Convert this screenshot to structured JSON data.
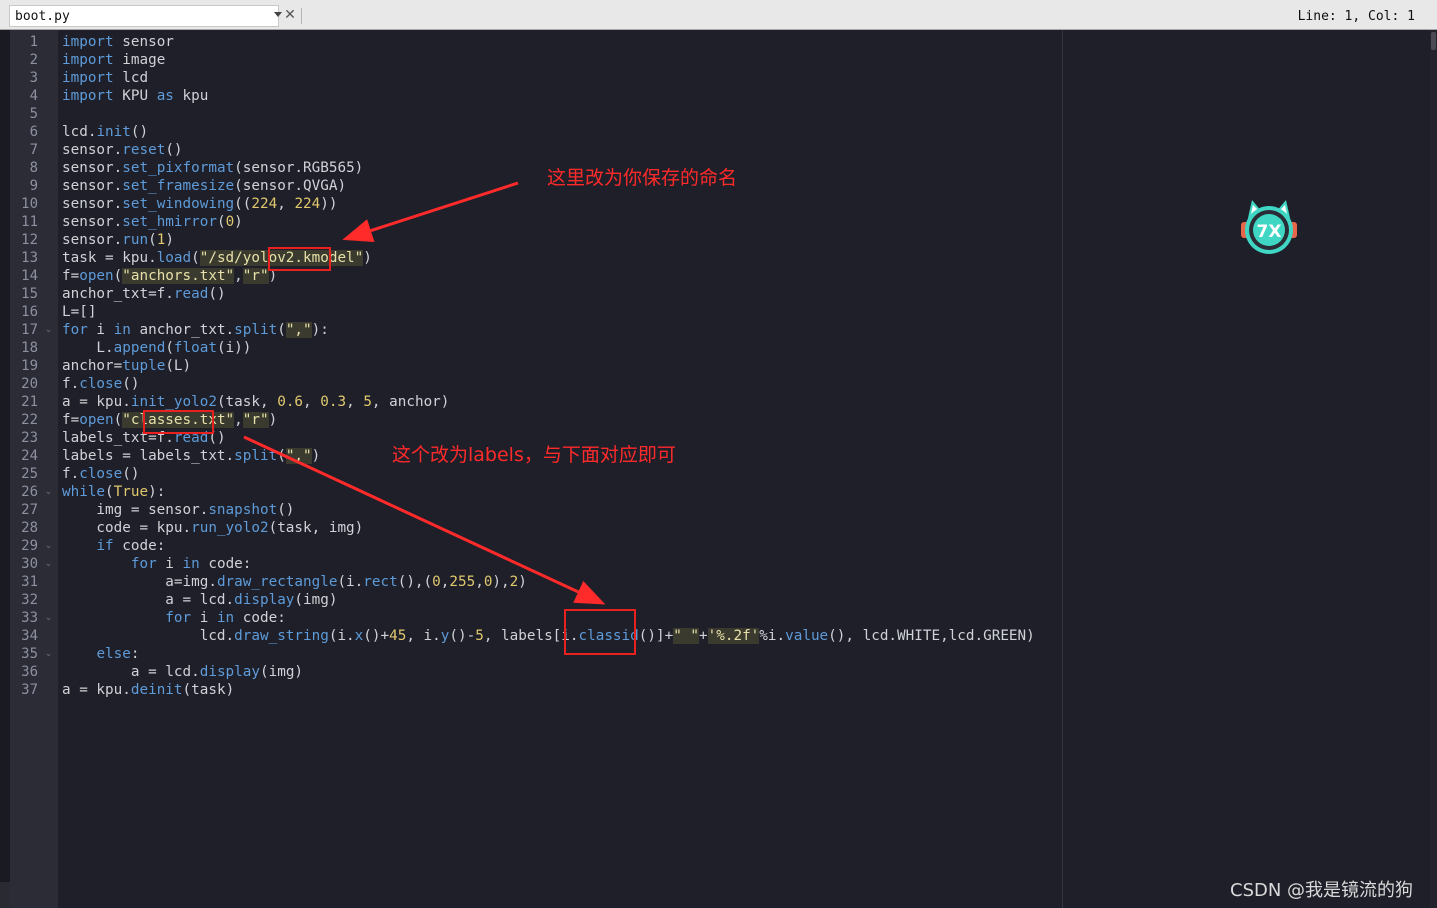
{
  "tab": {
    "filename": "boot.py",
    "close_symbol": "✕"
  },
  "status_bar": {
    "cursor": "Line: 1, Col: 1"
  },
  "code_lines": [
    [
      [
        "import",
        "kw"
      ],
      [
        " sensor",
        ""
      ]
    ],
    [
      [
        "import",
        "kw"
      ],
      [
        " image",
        ""
      ]
    ],
    [
      [
        "import",
        "kw"
      ],
      [
        " lcd",
        ""
      ]
    ],
    [
      [
        "import",
        "kw"
      ],
      [
        " KPU ",
        ""
      ],
      [
        "as",
        "kw"
      ],
      [
        " kpu",
        ""
      ]
    ],
    [],
    [
      [
        "lcd.",
        ""
      ],
      [
        "init",
        "fn"
      ],
      [
        "()",
        ""
      ]
    ],
    [
      [
        "sensor.",
        ""
      ],
      [
        "reset",
        "fn"
      ],
      [
        "()",
        ""
      ]
    ],
    [
      [
        "sensor.",
        ""
      ],
      [
        "set_pixformat",
        "fn"
      ],
      [
        "(sensor.RGB565)",
        ""
      ]
    ],
    [
      [
        "sensor.",
        ""
      ],
      [
        "set_framesize",
        "fn"
      ],
      [
        "(sensor.QVGA)",
        ""
      ]
    ],
    [
      [
        "sensor.",
        ""
      ],
      [
        "set_windowing",
        "fn"
      ],
      [
        "((",
        ""
      ],
      [
        "224",
        "num"
      ],
      [
        ", ",
        ""
      ],
      [
        "224",
        "num"
      ],
      [
        "))",
        ""
      ]
    ],
    [
      [
        "sensor.",
        ""
      ],
      [
        "set_hmirror",
        "fn"
      ],
      [
        "(",
        ""
      ],
      [
        "0",
        "num"
      ],
      [
        ")",
        ""
      ]
    ],
    [
      [
        "sensor.",
        ""
      ],
      [
        "run",
        "fn"
      ],
      [
        "(",
        ""
      ],
      [
        "1",
        "num"
      ],
      [
        ")",
        ""
      ]
    ],
    [
      [
        "task = kpu.",
        ""
      ],
      [
        "load",
        "fn"
      ],
      [
        "(",
        ""
      ],
      [
        "\"/sd/yolov2.kmodel\"",
        "str"
      ],
      [
        ")",
        ""
      ]
    ],
    [
      [
        "f=",
        ""
      ],
      [
        "open",
        "fn"
      ],
      [
        "(",
        ""
      ],
      [
        "\"anchors.txt\"",
        "str"
      ],
      [
        ",",
        ""
      ],
      [
        "\"r\"",
        "str"
      ],
      [
        ")",
        ""
      ]
    ],
    [
      [
        "anchor_txt=f.",
        ""
      ],
      [
        "read",
        "fn"
      ],
      [
        "()",
        ""
      ]
    ],
    [
      [
        "L=[]",
        ""
      ]
    ],
    [
      [
        "for",
        "kw"
      ],
      [
        " i ",
        ""
      ],
      [
        "in",
        "kw"
      ],
      [
        " anchor_txt.",
        ""
      ],
      [
        "split",
        "fn"
      ],
      [
        "(",
        ""
      ],
      [
        "\",\"",
        "str"
      ],
      [
        "):",
        ""
      ]
    ],
    [
      [
        "    L.",
        ""
      ],
      [
        "append",
        "fn"
      ],
      [
        "(",
        ""
      ],
      [
        "float",
        "fn"
      ],
      [
        "(i))",
        ""
      ]
    ],
    [
      [
        "anchor=",
        ""
      ],
      [
        "tuple",
        "fn"
      ],
      [
        "(L)",
        ""
      ]
    ],
    [
      [
        "f.",
        ""
      ],
      [
        "close",
        "fn"
      ],
      [
        "()",
        ""
      ]
    ],
    [
      [
        "a = kpu.",
        ""
      ],
      [
        "init_yolo2",
        "fn"
      ],
      [
        "(task, ",
        ""
      ],
      [
        "0.6",
        "num"
      ],
      [
        ", ",
        ""
      ],
      [
        "0.3",
        "num"
      ],
      [
        ", ",
        ""
      ],
      [
        "5",
        "num"
      ],
      [
        ", anchor)",
        ""
      ]
    ],
    [
      [
        "f=",
        ""
      ],
      [
        "open",
        "fn"
      ],
      [
        "(",
        ""
      ],
      [
        "\"classes.txt\"",
        "str"
      ],
      [
        ",",
        ""
      ],
      [
        "\"r\"",
        "str"
      ],
      [
        ")",
        ""
      ]
    ],
    [
      [
        "labels_txt=f.",
        ""
      ],
      [
        "read",
        "fn"
      ],
      [
        "()",
        ""
      ]
    ],
    [
      [
        "labels = labels_txt.",
        ""
      ],
      [
        "split",
        "fn"
      ],
      [
        "(",
        ""
      ],
      [
        "\",\"",
        "str"
      ],
      [
        ")",
        ""
      ]
    ],
    [
      [
        "f.",
        ""
      ],
      [
        "close",
        "fn"
      ],
      [
        "()",
        ""
      ]
    ],
    [
      [
        "while",
        "kw"
      ],
      [
        "(",
        ""
      ],
      [
        "True",
        "num"
      ],
      [
        "):",
        ""
      ]
    ],
    [
      [
        "    img = sensor.",
        ""
      ],
      [
        "snapshot",
        "fn"
      ],
      [
        "()",
        ""
      ]
    ],
    [
      [
        "    code = kpu.",
        ""
      ],
      [
        "run_yolo2",
        "fn"
      ],
      [
        "(task, img)",
        ""
      ]
    ],
    [
      [
        "    ",
        ""
      ],
      [
        "if",
        "kw"
      ],
      [
        " code:",
        ""
      ]
    ],
    [
      [
        "        ",
        ""
      ],
      [
        "for",
        "kw"
      ],
      [
        " i ",
        ""
      ],
      [
        "in",
        "kw"
      ],
      [
        " code:",
        ""
      ]
    ],
    [
      [
        "            a=img.",
        ""
      ],
      [
        "draw_rectangle",
        "fn"
      ],
      [
        "(i.",
        ""
      ],
      [
        "rect",
        "fn"
      ],
      [
        "(),(",
        ""
      ],
      [
        "0",
        "num"
      ],
      [
        ",",
        ""
      ],
      [
        "255",
        "num"
      ],
      [
        ",",
        ""
      ],
      [
        "0",
        "num"
      ],
      [
        "),",
        ""
      ],
      [
        "2",
        "num"
      ],
      [
        ")",
        ""
      ]
    ],
    [
      [
        "            a = lcd.",
        ""
      ],
      [
        "display",
        "fn"
      ],
      [
        "(img)",
        ""
      ]
    ],
    [
      [
        "            ",
        ""
      ],
      [
        "for",
        "kw"
      ],
      [
        " i ",
        ""
      ],
      [
        "in",
        "kw"
      ],
      [
        " code:",
        ""
      ]
    ],
    [
      [
        "                lcd.",
        ""
      ],
      [
        "draw_string",
        "fn"
      ],
      [
        "(i.",
        ""
      ],
      [
        "x",
        "fn"
      ],
      [
        "()+",
        ""
      ],
      [
        "45",
        "num"
      ],
      [
        ", i.",
        ""
      ],
      [
        "y",
        "fn"
      ],
      [
        "()-",
        ""
      ],
      [
        "5",
        "num"
      ],
      [
        ", labels[i.",
        ""
      ],
      [
        "classid",
        "fn"
      ],
      [
        "()]+",
        ""
      ],
      [
        "\" \"",
        "str"
      ],
      [
        "+",
        ""
      ],
      [
        "'%.2f'",
        "str"
      ],
      [
        "%i.",
        ""
      ],
      [
        "value",
        "fn"
      ],
      [
        "(), lcd.WHITE,lcd.GREEN)",
        ""
      ]
    ],
    [
      [
        "    ",
        ""
      ],
      [
        "else",
        "kw"
      ],
      [
        ":",
        ""
      ]
    ],
    [
      [
        "        a = lcd.",
        ""
      ],
      [
        "display",
        "fn"
      ],
      [
        "(img)",
        ""
      ]
    ],
    [
      [
        "a = kpu.",
        ""
      ],
      [
        "deinit",
        "fn"
      ],
      [
        "(task)",
        ""
      ]
    ]
  ],
  "annotations": {
    "model_name_note": "这里改为你保存的命名",
    "labels_note": "这个改为labels，与下面对应即可"
  },
  "watermark": "CSDN @我是镜流的狗",
  "colors": {
    "keyword": "#5e9bd8",
    "number": "#e0c86e",
    "string": "#e6e0a8",
    "annotation": "#ff2a2a"
  },
  "logo_icon": "cat-avatar-icon"
}
